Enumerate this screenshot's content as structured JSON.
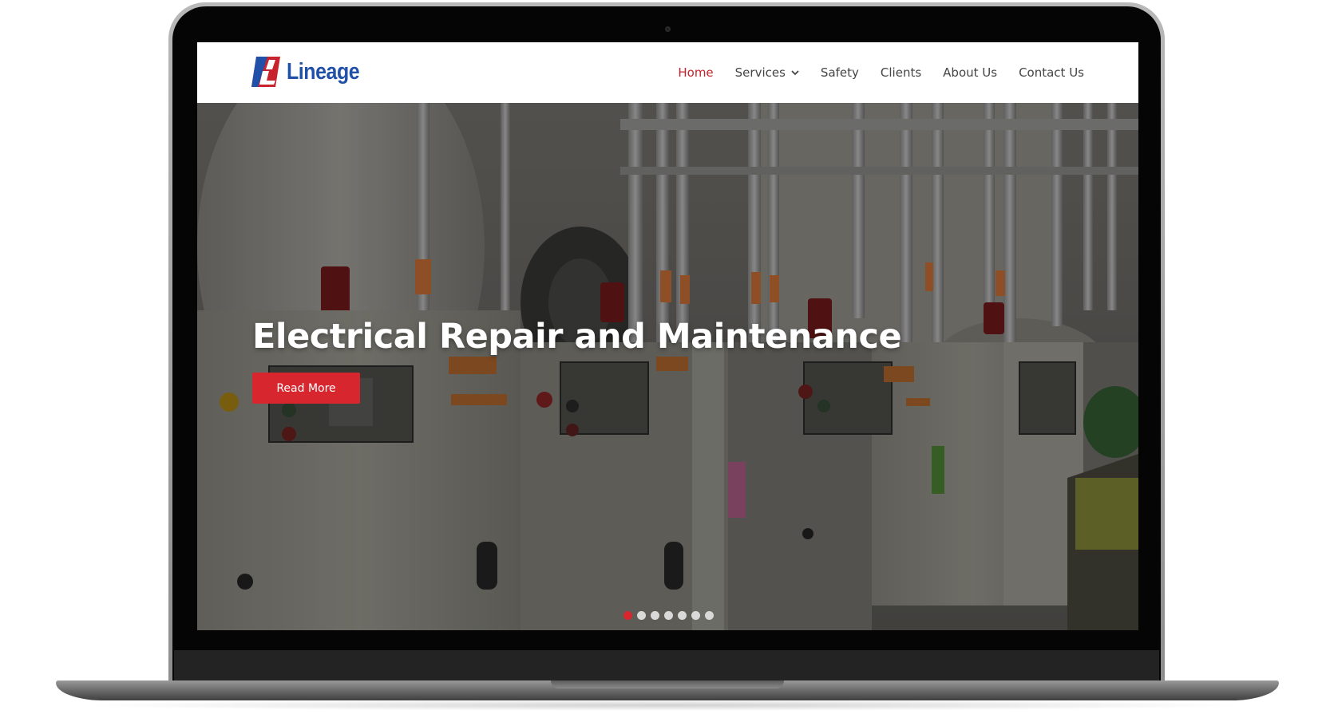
{
  "site": {
    "logo_text": "Lineage",
    "logo_icon": "lineage-logo-mark"
  },
  "nav": {
    "items": [
      {
        "label": "Home",
        "active": true
      },
      {
        "label": "Services",
        "active": false,
        "has_dropdown": true,
        "icon": "chevron-down-icon"
      },
      {
        "label": "Safety",
        "active": false
      },
      {
        "label": "Clients",
        "active": false
      },
      {
        "label": "About Us",
        "active": false
      },
      {
        "label": "Contact Us",
        "active": false
      }
    ]
  },
  "hero": {
    "title": "Electrical Repair and Maintenance",
    "button_label": "Read More",
    "slides": 7,
    "active_slide": 1,
    "background": "photo of electrical control panels with conduit pipes"
  },
  "colors": {
    "accent": "#d7262e",
    "nav_active": "#c8232c",
    "brand_blue": "#2150a8",
    "nav_text": "#444444"
  }
}
